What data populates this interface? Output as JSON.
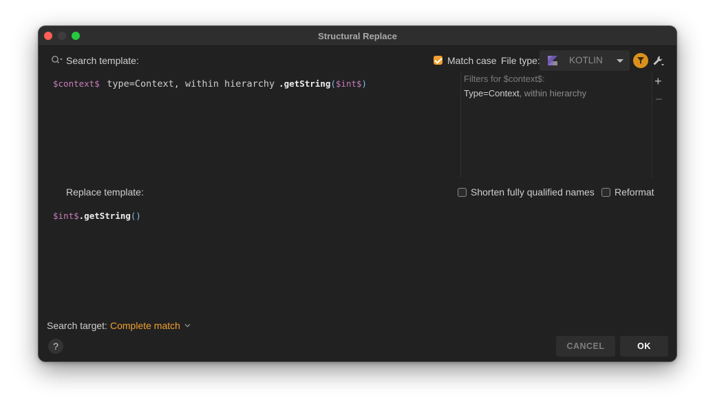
{
  "window": {
    "title": "Structural Replace"
  },
  "search": {
    "label": "Search template:",
    "match_case_label": "Match case",
    "match_case_checked": true,
    "file_type_label": "File type:",
    "file_type_value": "KOTLIN",
    "template": {
      "var1": "$context$",
      "filter": "type=Context, within hierarchy",
      "method": ".getString",
      "open": "(",
      "var2": "$int$",
      "close": ")"
    }
  },
  "filters": {
    "title": "Filters for $context$:",
    "value_main": "Type=Context",
    "value_rest": ", within hierarchy",
    "add_symbol": "+",
    "remove_symbol": "−"
  },
  "replace": {
    "label": "Replace template:",
    "shorten_label": "Shorten fully qualified names",
    "shorten_checked": false,
    "reformat_label": "Reformat",
    "reformat_checked": false,
    "template": {
      "var": "$int$",
      "method": ".getString",
      "parens": "()"
    }
  },
  "footer": {
    "search_target_label": "Search target:",
    "search_target_value": "Complete match",
    "help_symbol": "?",
    "cancel_label": "CANCEL",
    "ok_label": "OK"
  },
  "colors": {
    "accent": "#f0a030",
    "variable": "#c77dbb",
    "paren": "#84c0e8",
    "background": "#212121"
  },
  "icons": [
    "search-options-icon",
    "kotlin-icon",
    "dropdown-arrow-icon",
    "filter-icon",
    "wrench-icon",
    "add-icon",
    "remove-icon",
    "chevron-down-icon",
    "help-icon"
  ]
}
